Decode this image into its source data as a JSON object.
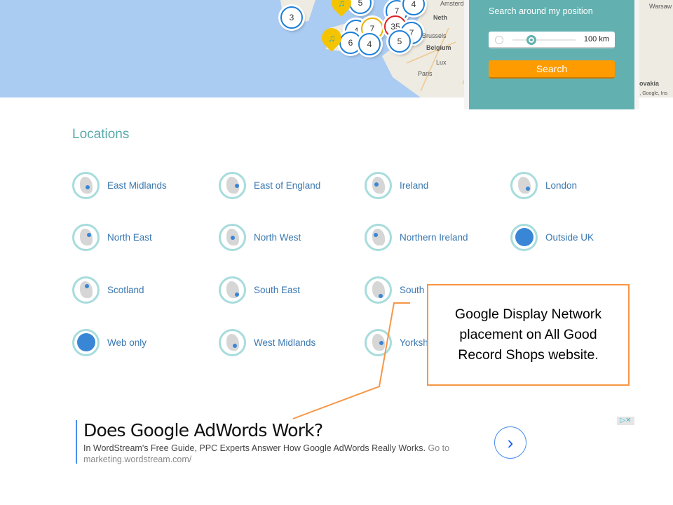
{
  "map": {
    "clusters": [
      "3",
      "5",
      "7",
      "4",
      "4",
      "7",
      "35",
      "7",
      "6",
      "4",
      "5"
    ],
    "labels": [
      "Amsterd",
      "Neth",
      "Brussels",
      "Belgium",
      "Lux",
      "Paris",
      "Warsaw",
      "ovakia",
      "), Google, Ins"
    ]
  },
  "search_panel": {
    "title": "Search around my position",
    "radius": "100",
    "unit": "km",
    "radius_fraction": 0.3,
    "button": "Search",
    "accent": "#62b1b0",
    "button_color": "#fd9b00"
  },
  "locations": {
    "title": "Locations",
    "items": [
      {
        "label": "East Midlands"
      },
      {
        "label": "East of England"
      },
      {
        "label": "Ireland"
      },
      {
        "label": "London"
      },
      {
        "label": "North East"
      },
      {
        "label": "North West"
      },
      {
        "label": "Northern Ireland"
      },
      {
        "label": "Outside UK"
      },
      {
        "label": "Scotland"
      },
      {
        "label": "South East"
      },
      {
        "label": "South"
      },
      {
        "label": ""
      },
      {
        "label": "Web only"
      },
      {
        "label": "West Midlands"
      },
      {
        "label": "Yorksh Humb"
      }
    ]
  },
  "callout": {
    "text": "Google Display Network placement on All Good Record Shops website.",
    "color": "#f79646"
  },
  "ad": {
    "title": "Does Google AdWords Work?",
    "description": "In WordStream's Free Guide, PPC Experts Answer How Google AdWords Really Works.",
    "link_text": "Go to marketing.wordstream.com/",
    "arrow": "›",
    "adchoices": "▷✕"
  }
}
